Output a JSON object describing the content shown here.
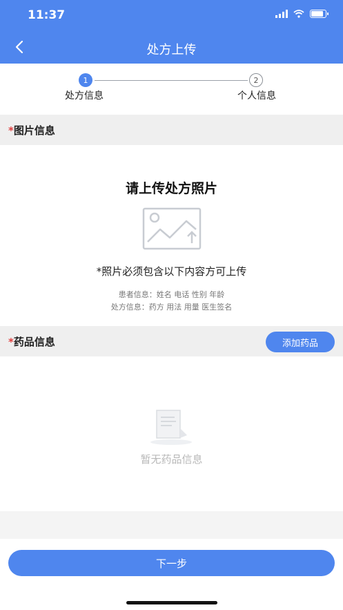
{
  "status_bar": {
    "time": "11:37"
  },
  "nav": {
    "title": "处方上传"
  },
  "steps": [
    {
      "number": "1",
      "label": "处方信息",
      "active": true
    },
    {
      "number": "2",
      "label": "个人信息",
      "active": false
    }
  ],
  "image_section": {
    "required_mark": "*",
    "title": "图片信息",
    "upload_title": "请上传处方照片",
    "requirement": "*照片必须包含以下内容方可上传",
    "patient_info": "患者信息：姓名 电话 性别 年龄",
    "prescription_info": "处方信息：药方 用法 用量 医生签名"
  },
  "drug_section": {
    "required_mark": "*",
    "title": "药品信息",
    "add_button": "添加药品",
    "empty_text": "暂无药品信息"
  },
  "footer": {
    "next_button": "下一步"
  },
  "colors": {
    "accent": "#4f86ee",
    "required": "#e04040"
  }
}
